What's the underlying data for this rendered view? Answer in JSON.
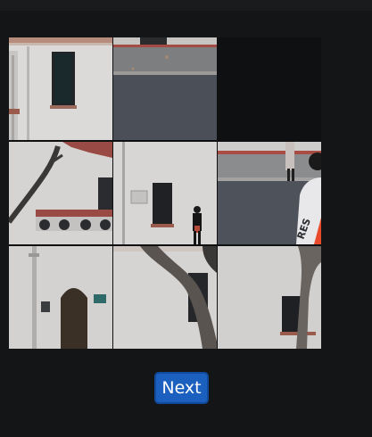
{
  "puzzle": {
    "tiles": [
      {
        "name": "tile-window-wall",
        "pos": "row1-col1"
      },
      {
        "name": "tile-road-curb",
        "pos": "row1-col2"
      },
      {
        "name": "tile-tree-balcony",
        "pos": "row2-col1"
      },
      {
        "name": "tile-person-window",
        "pos": "row2-col2"
      },
      {
        "name": "tile-person-road",
        "pos": "row2-col3"
      },
      {
        "name": "tile-door-wall",
        "pos": "row3-col1"
      },
      {
        "name": "tile-tree-trunk",
        "pos": "row3-col2"
      },
      {
        "name": "tile-wall-window-right",
        "pos": "row3-col3"
      }
    ],
    "empty_slot": "row1-col3"
  },
  "controls": {
    "next_label": "Next"
  },
  "colors": {
    "background": "#141517",
    "button": "#1b5fbf",
    "button_border": "#124a9b"
  }
}
